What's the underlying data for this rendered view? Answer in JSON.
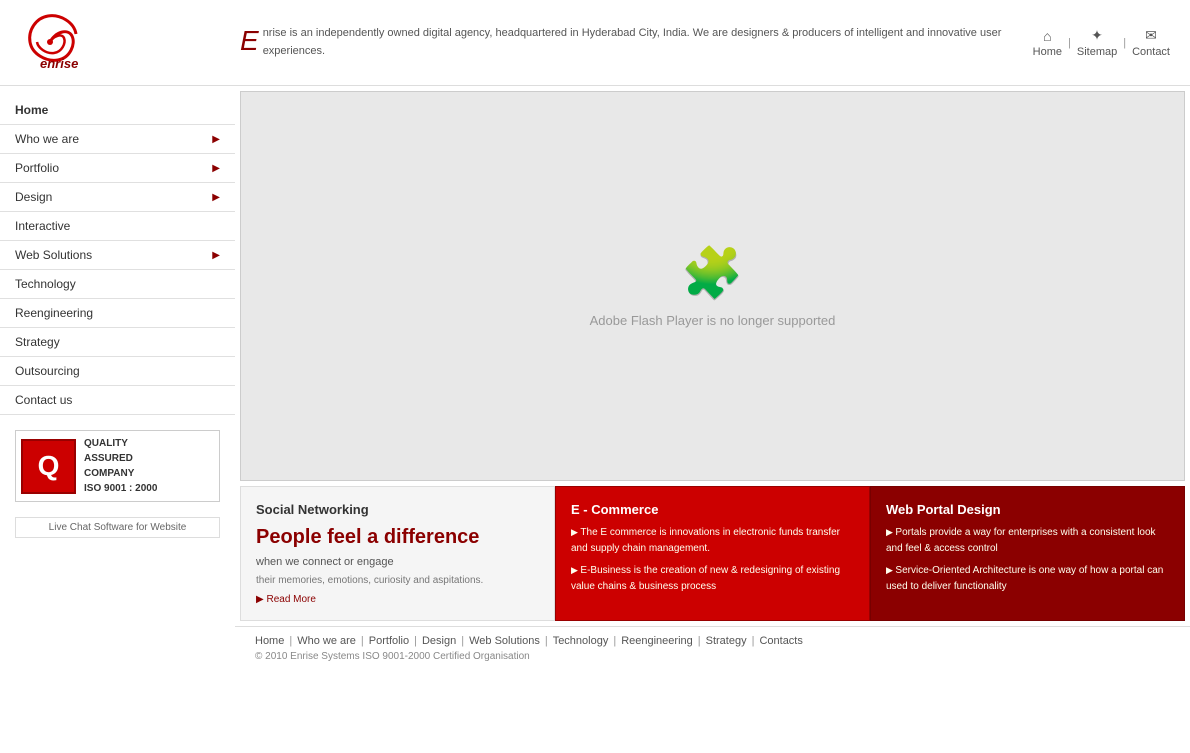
{
  "header": {
    "logo_text": "enrise",
    "desc_bold": "E",
    "desc": "nrise is an independently owned digital agency, headquartered in Hyderabad City, India.\nWe are designers & producers of intelligent and innovative user experiences.",
    "nav": {
      "home": "Home",
      "sitemap": "Sitemap",
      "contact": "Contact"
    }
  },
  "sidebar": {
    "menu": [
      {
        "label": "Home",
        "arrow": false
      },
      {
        "label": "Who we are",
        "arrow": true
      },
      {
        "label": "Portfolio",
        "arrow": true
      },
      {
        "label": "Design",
        "arrow": true
      },
      {
        "label": "Interactive",
        "arrow": false
      },
      {
        "label": "Web Solutions",
        "arrow": true
      },
      {
        "label": "Technology",
        "arrow": false
      },
      {
        "label": "Reengineering",
        "arrow": false
      },
      {
        "label": "Strategy",
        "arrow": false
      },
      {
        "label": "Outsourcing",
        "arrow": false
      },
      {
        "label": "Contact us",
        "arrow": false
      }
    ],
    "quality": {
      "q_letter": "Q",
      "line1": "QUALITY",
      "line2": "ASSURED",
      "line3": "COMPANY",
      "line4": "ISO 9001 : 2000"
    },
    "livechat": "Live Chat Software for Website"
  },
  "flash": {
    "icon": "🧩",
    "message": "Adobe Flash Player is no longer supported"
  },
  "panels": {
    "social": {
      "title": "Social Networking",
      "headline_line1": "People feel a difference",
      "headline_line2": "when we connect or engage",
      "sub": "their memories, emotions, curiosity and aspitations.",
      "read_more": "▶ Read More"
    },
    "ecommerce": {
      "title": "E - Commerce",
      "bullet1": "The E commerce is innovations in electronic funds transfer and supply chain management.",
      "bullet2": "E-Business is the creation of new & redesigning of existing value chains & business process"
    },
    "webportal": {
      "title": "Web Portal Design",
      "bullet1": "Portals provide a way for enterprises with a consistent look and feel & access control",
      "bullet2": "Service-Oriented Architecture is one way of how a portal can used to deliver functionality"
    }
  },
  "footer": {
    "links": [
      "Home",
      "Who we are",
      "Portfolio",
      "Design",
      "Web Solutions",
      "Technology",
      "Reengineering",
      "Strategy",
      "Contacts"
    ],
    "copyright": "© 2010 Enrise Systems ISO 9001-2000 Certified Organisation"
  }
}
